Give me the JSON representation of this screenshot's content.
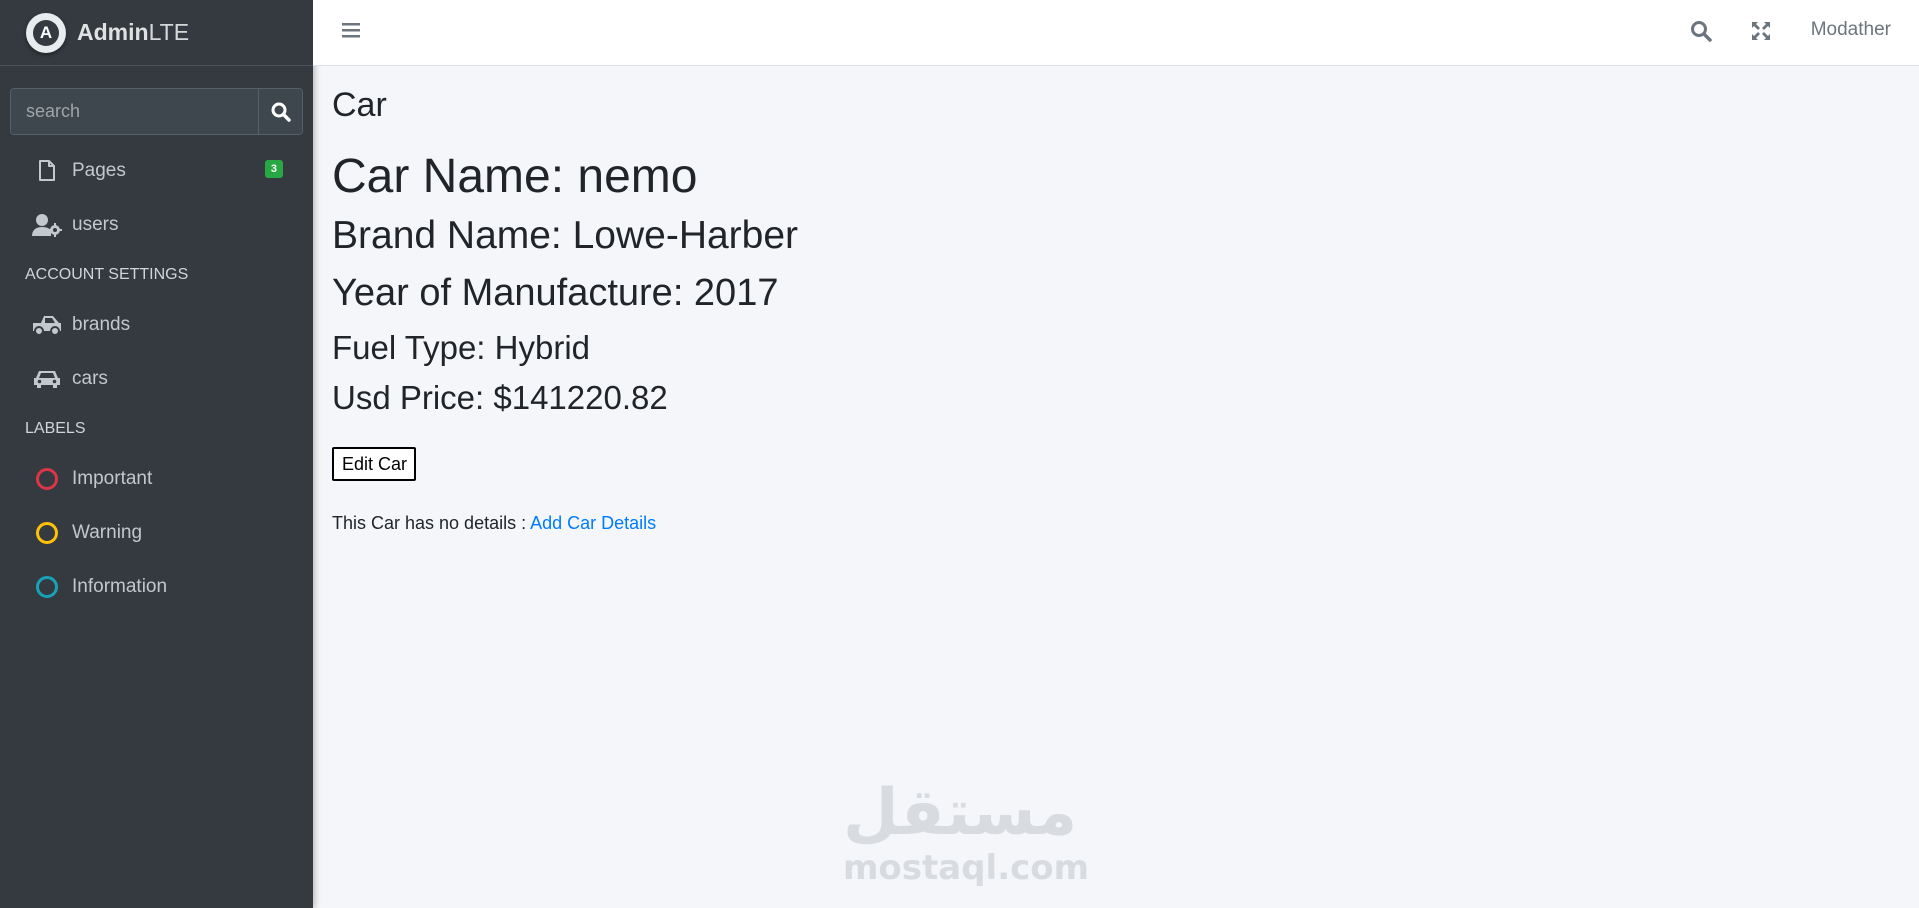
{
  "brand": {
    "name_bold": "Admin",
    "name_light": "LTE",
    "logo_letter": "A"
  },
  "search": {
    "placeholder": "search"
  },
  "sidebar": {
    "items": [
      {
        "label": "Pages",
        "icon": "file-icon",
        "badge": "3"
      },
      {
        "label": "users",
        "icon": "users-cog-icon"
      }
    ],
    "account_header": "ACCOUNT SETTINGS",
    "account_items": [
      {
        "label": "brands",
        "icon": "truck-pickup-icon"
      },
      {
        "label": "cars",
        "icon": "car-icon"
      }
    ],
    "labels_header": "LABELS",
    "labels": [
      {
        "label": "Important",
        "color": "#dc3545"
      },
      {
        "label": "Warning",
        "color": "#ffc107"
      },
      {
        "label": "Information",
        "color": "#17a2b8"
      }
    ]
  },
  "topbar": {
    "user": "Modather"
  },
  "content": {
    "title": "Car",
    "car_name": "Car Name: nemo",
    "brand_name": "Brand Name: Lowe-Harber",
    "year": "Year of Manufacture: 2017",
    "fuel": "Fuel Type: Hybrid",
    "price": "Usd Price: $141220.82",
    "edit_button": "Edit Car",
    "no_details_text": "This Car has no details : ",
    "add_details_link": "Add Car Details"
  },
  "watermark": {
    "arabic": "مستقل",
    "latin": "mostaql.com"
  }
}
